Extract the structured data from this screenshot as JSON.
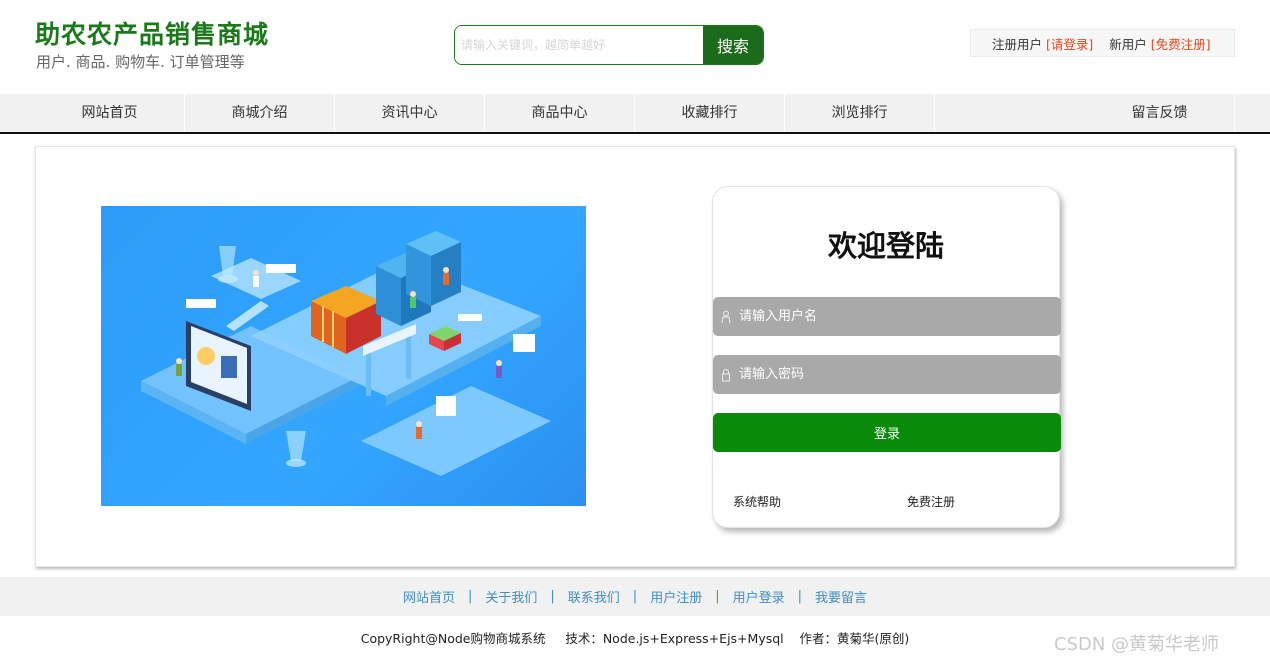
{
  "header": {
    "title": "助农农产品销售商城",
    "subtitle": "用户. 商品. 购物车. 订单管理等",
    "search": {
      "placeholder": "请输入关键词，越简单越好",
      "button": "搜索"
    },
    "user": {
      "registered_label": "注册用户",
      "login_link": "[请登录]",
      "new_label": "新用户",
      "register_link": "[免费注册]"
    }
  },
  "nav": {
    "items": [
      "网站首页",
      "商城介绍",
      "资讯中心",
      "商品中心",
      "收藏排行",
      "浏览排行",
      "留言反馈"
    ]
  },
  "login": {
    "title": "欢迎登陆",
    "username_placeholder": "请输入用户名",
    "password_placeholder": "请输入密码",
    "submit": "登录",
    "help_link": "系统帮助",
    "register_link": "免费注册"
  },
  "footer": {
    "links": [
      "网站首页",
      "关于我们",
      "联系我们",
      "用户注册",
      "用户登录",
      "我要留言"
    ],
    "separator": "|",
    "copyright": "CopyRight@Node购物商城系统     技术：Node.js+Express+Ejs+Mysql    作者：黄菊华(原创)"
  },
  "watermark": "CSDN @黄菊华老师",
  "colors": {
    "brand": "#1a7a1a",
    "login_button": "#0a8a0a",
    "link": "#e8471a",
    "footer_link": "#3d8fc9"
  },
  "icons": [
    "user-icon",
    "lock-icon"
  ]
}
